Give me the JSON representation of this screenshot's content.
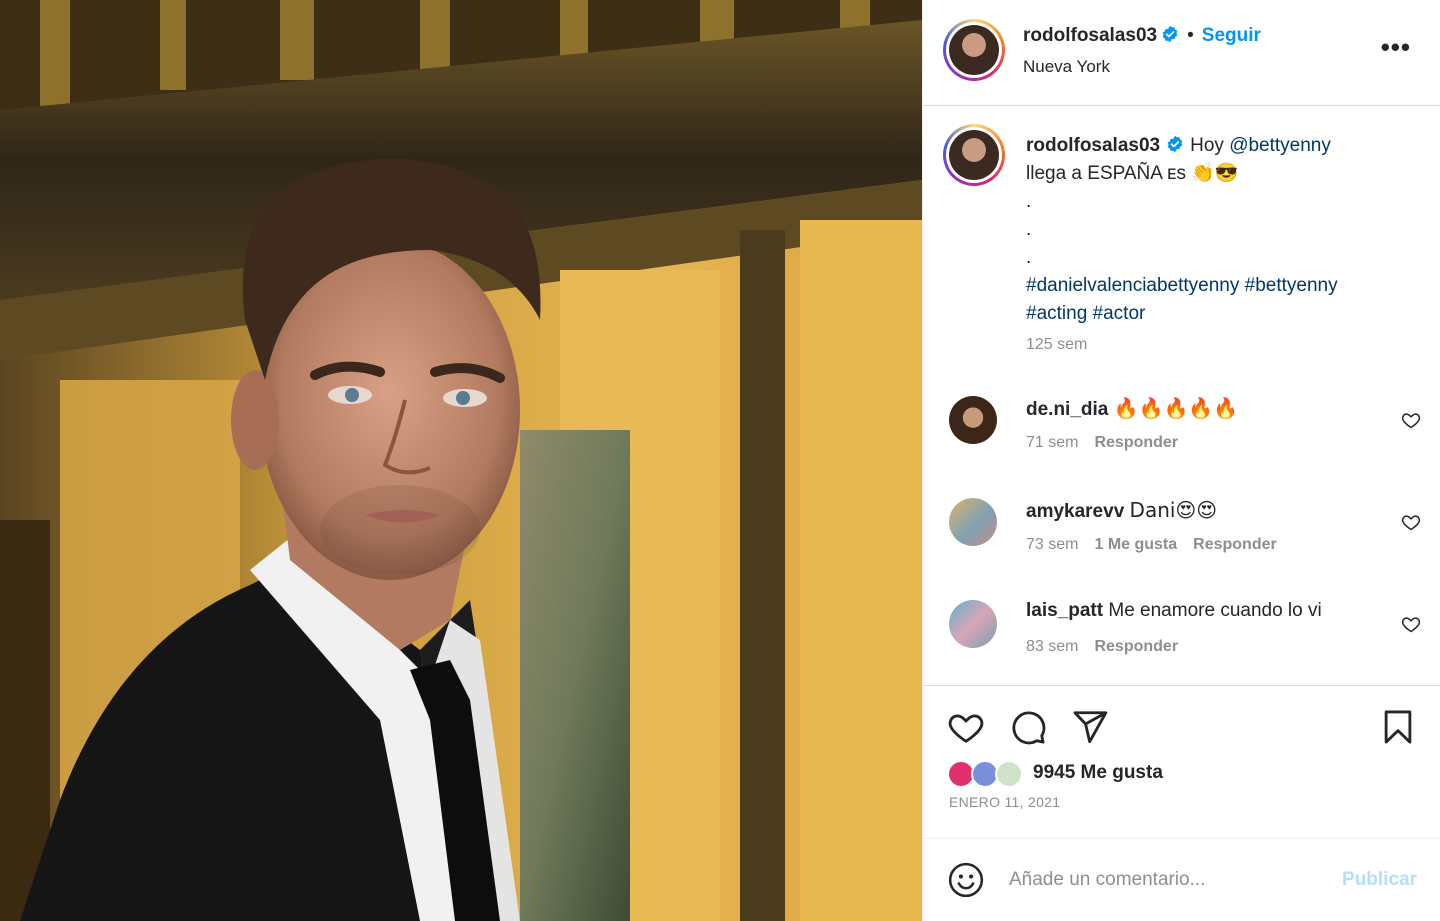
{
  "post": {
    "author": "rodolfosalas03",
    "verified_icon": "verified-badge-icon",
    "follow_label": "Seguir",
    "separator": "•",
    "location": "Nueva York",
    "more_icon": "more-options-icon",
    "more_glyph": "•••"
  },
  "caption": {
    "author": "rodolfosalas03",
    "text_before_mention": "Hoy ",
    "mention": "@bettyenny",
    "line2": "llega a ESPAÑA ᴇs 👏😎",
    "dots": [
      ".",
      ".",
      "."
    ],
    "hashtags_line1": "#danielvalenciabettyenny #bettyenny",
    "hashtags_line2": "#acting #actor",
    "time": "125 sem"
  },
  "comments": [
    {
      "user": "de.ni_dia",
      "text": "🔥🔥🔥🔥🔥",
      "time": "71 sem",
      "likes": "",
      "reply": "Responder"
    },
    {
      "user": "amykarevv",
      "text": "Dani😍😍",
      "time": "73 sem",
      "likes": "1 Me gusta",
      "reply": "Responder"
    },
    {
      "user": "lais_patt",
      "text": "Me enamore cuando lo vi",
      "time": "83 sem",
      "likes": "",
      "reply": "Responder"
    }
  ],
  "actions": {
    "like_icon": "heart-icon",
    "comment_icon": "comment-bubble-icon",
    "share_icon": "paper-plane-icon",
    "save_icon": "bookmark-icon",
    "likes_text": "9945 Me gusta",
    "date": "ENERO 11, 2021"
  },
  "add_comment": {
    "emoji_icon": "emoji-smile-icon",
    "placeholder": "Añade un comentario...",
    "publish_label": "Publicar"
  },
  "colors": {
    "link_blue": "#0095f6",
    "hashtag": "#00376b",
    "muted": "#8e8e8e",
    "publish_disabled": "#b2dffc"
  }
}
